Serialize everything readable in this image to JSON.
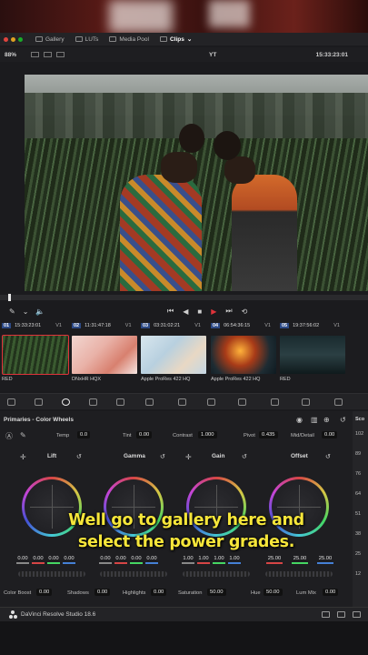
{
  "menubar": {
    "tabs": [
      {
        "label": "Gallery",
        "icon": "gallery-icon"
      },
      {
        "label": "LUTs",
        "icon": "lut-icon"
      },
      {
        "label": "Media Pool",
        "icon": "media-pool-icon"
      },
      {
        "label": "Clips",
        "icon": "clips-icon"
      }
    ],
    "window_dot_colors": [
      "#e0443e",
      "#dea123",
      "#1aab29"
    ]
  },
  "viewer": {
    "zoom": "88%",
    "project": "YT",
    "timecode": "15:33:23:01"
  },
  "clips": [
    {
      "num": "01",
      "tc": "15:33:23:01",
      "track": "V1",
      "label": "RED"
    },
    {
      "num": "02",
      "tc": "11:31:47:18",
      "track": "V1",
      "label": "DNxHR HQX"
    },
    {
      "num": "03",
      "tc": "03:31:02:21",
      "track": "V1",
      "label": "Apple ProRes 422 HQ"
    },
    {
      "num": "04",
      "tc": "06:54:36:15",
      "track": "V1",
      "label": "Apple ProRes 422 HQ"
    },
    {
      "num": "05",
      "tc": "19:37:56:02",
      "track": "V1",
      "label": "RED"
    }
  ],
  "primaries": {
    "title": "Primaries - Color Wheels",
    "temp_label": "Temp",
    "temp": "0.0",
    "tint_label": "Tint",
    "tint": "0.00",
    "contrast_label": "Contrast",
    "contrast": "1.000",
    "pivot_label": "Pivot",
    "pivot": "0.435",
    "middetail_label": "Mid/Detail",
    "middetail": "0.00",
    "wheels": [
      {
        "name": "Lift",
        "values": [
          "0.00",
          "0.00",
          "0.00",
          "0.00"
        ]
      },
      {
        "name": "Gamma",
        "values": [
          "0.00",
          "0.00",
          "0.00",
          "0.00"
        ]
      },
      {
        "name": "Gain",
        "values": [
          "1.00",
          "1.00",
          "1.00",
          "1.00"
        ]
      },
      {
        "name": "Offset",
        "values": [
          "25.00",
          "25.00",
          "25.00"
        ]
      }
    ],
    "colorboost_label": "Color Boost",
    "colorboost": "0.00",
    "shadows_label": "Shadows",
    "shadows": "0.00",
    "highlights_label": "Highlights",
    "highlights": "0.00",
    "saturation_label": "Saturation",
    "saturation": "50.00",
    "hue_label": "Hue",
    "hue": "50.00",
    "lummix_label": "Lum Mix",
    "lummix": "0.00"
  },
  "side": {
    "label": "Sco",
    "numbers": [
      "102",
      "89",
      "76",
      "64",
      "51",
      "38",
      "25",
      "12"
    ]
  },
  "caption": {
    "line1": "Well go to gallery here and",
    "line2": "select the power grades."
  },
  "footer": {
    "app": "DaVinci Resolve Studio 18.6"
  }
}
